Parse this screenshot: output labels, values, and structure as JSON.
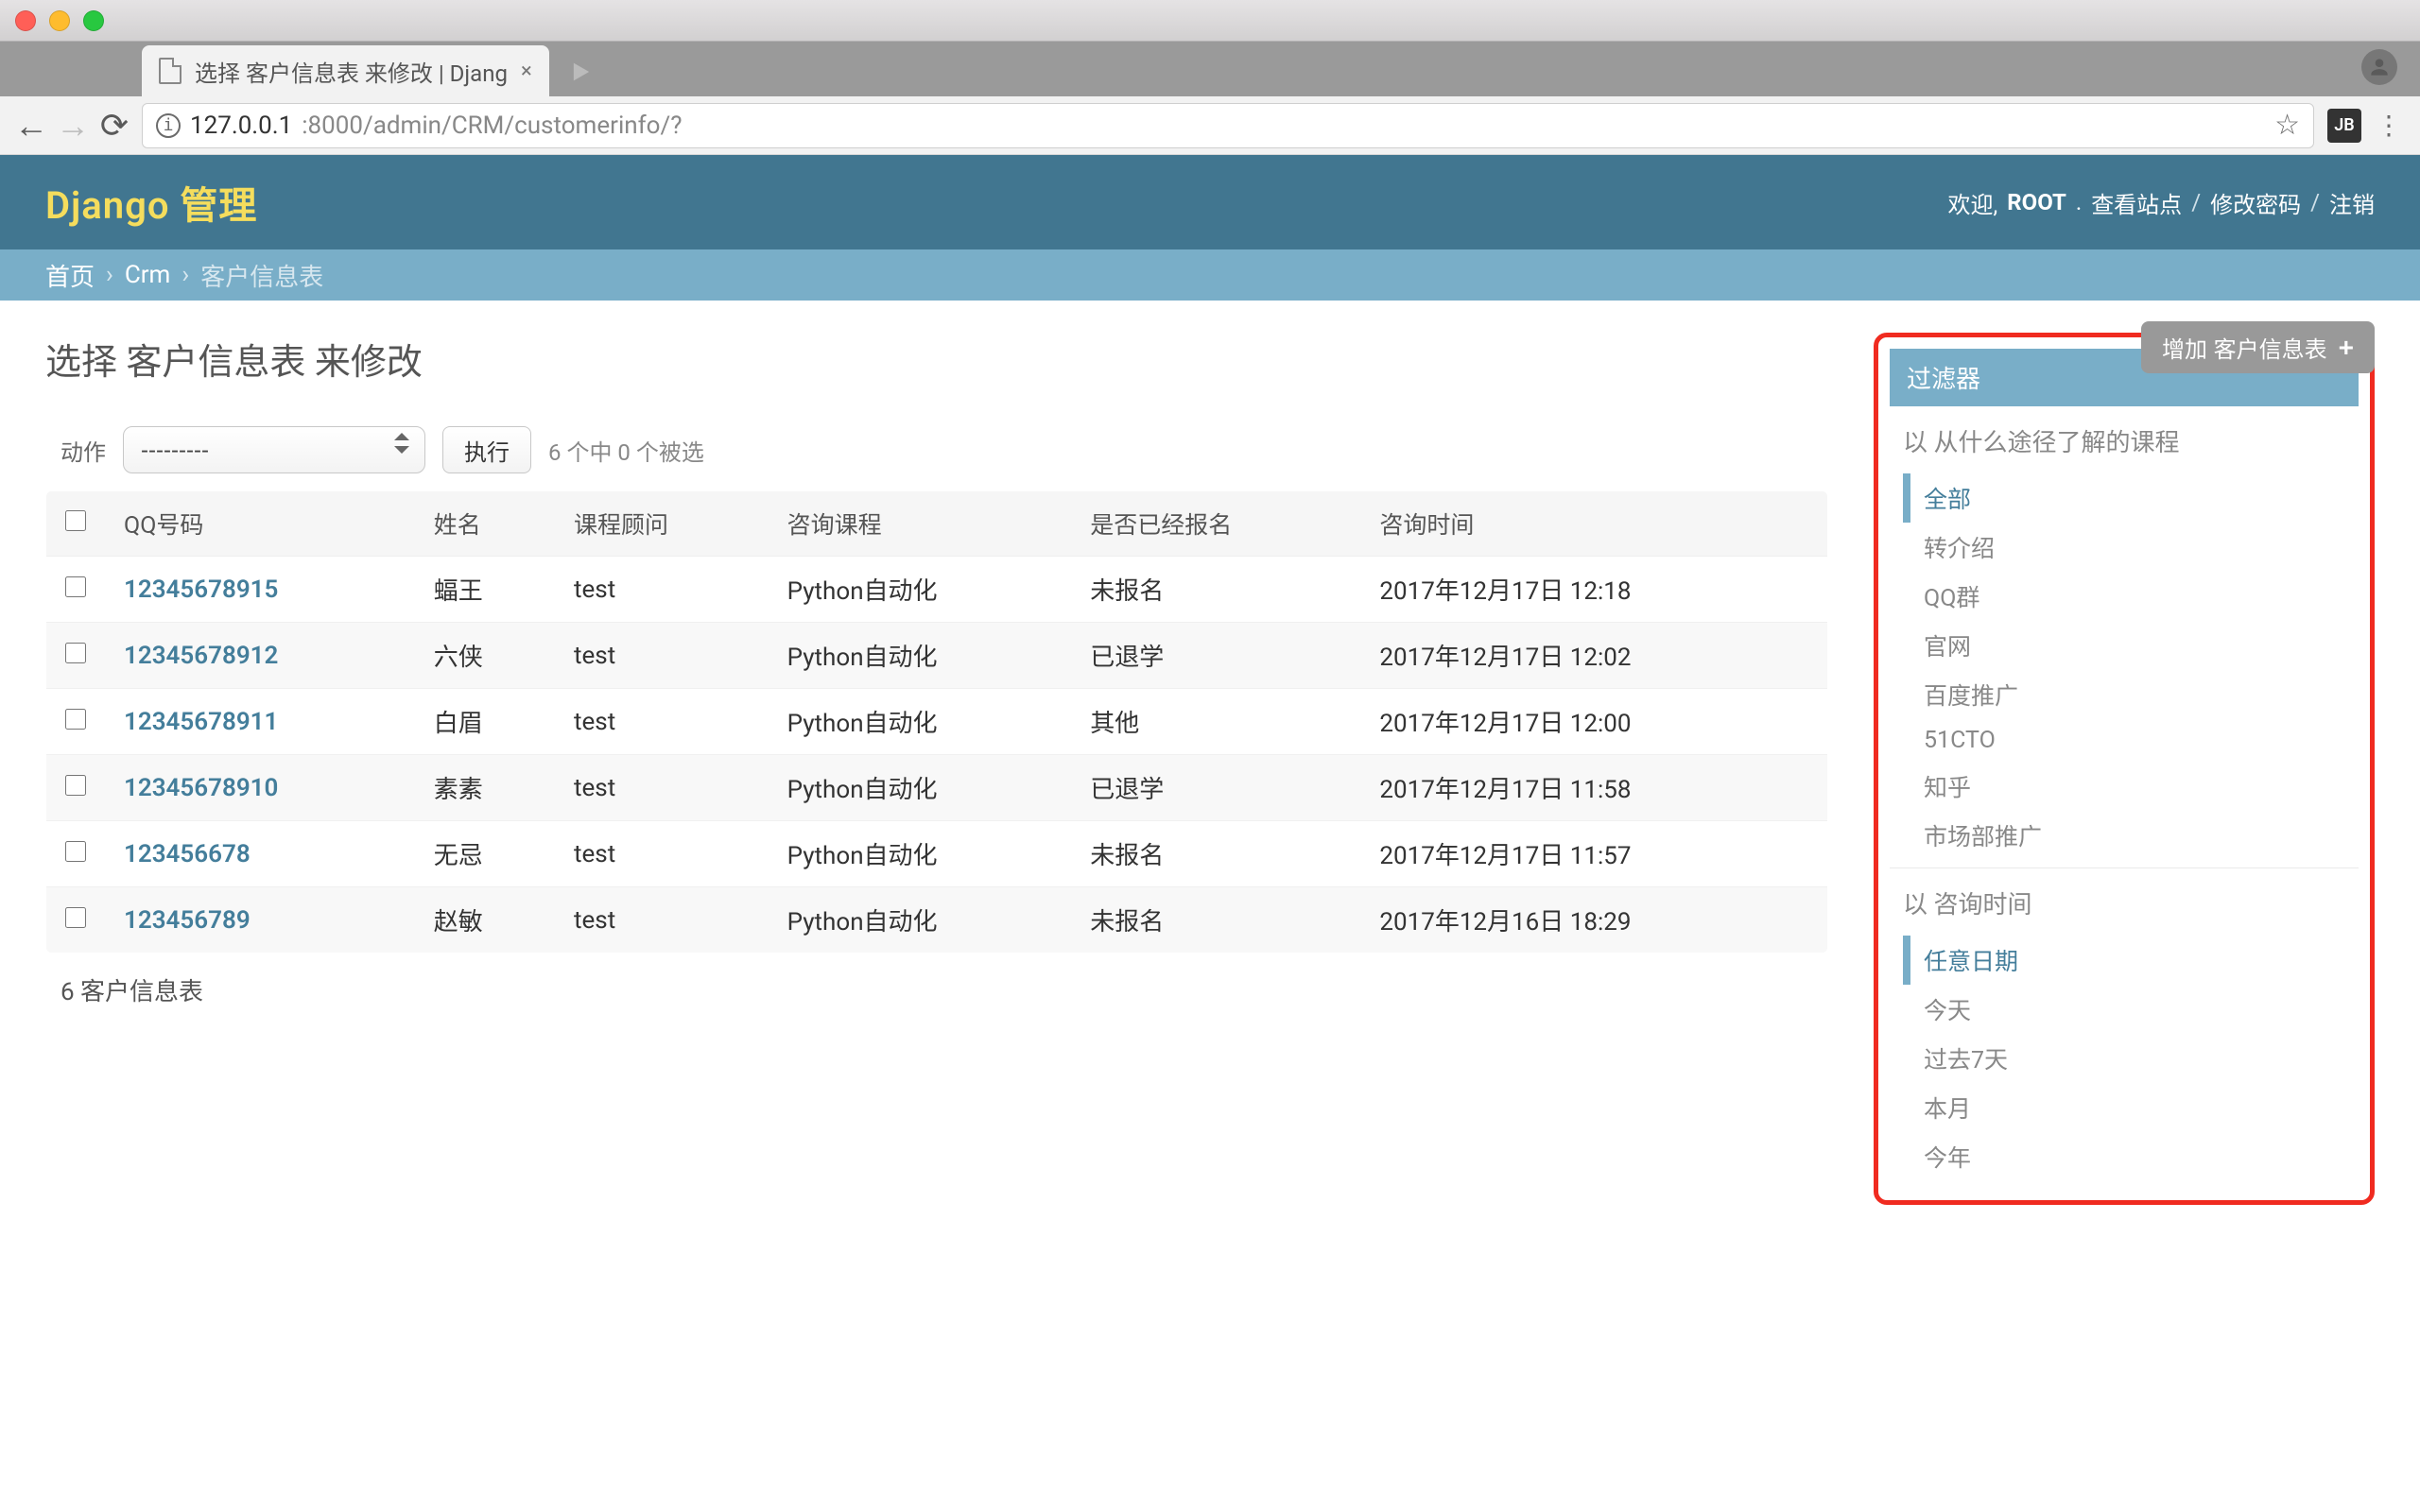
{
  "browser": {
    "tab_title": "选择 客户信息表 来修改 | Djang",
    "url_host": "127.0.0.1",
    "url_port_path": ":8000/admin/CRM/customerinfo/?"
  },
  "header": {
    "brand": "Django 管理",
    "welcome": "欢迎,",
    "user": "ROOT",
    "links": {
      "view_site": "查看站点",
      "change_password": "修改密码",
      "logout": "注销"
    }
  },
  "breadcrumbs": {
    "home": "首页",
    "app": "Crm",
    "model": "客户信息表"
  },
  "page": {
    "title": "选择 客户信息表 来修改",
    "add_button": "增加 客户信息表",
    "action_label": "动作",
    "action_placeholder": "---------",
    "go_label": "执行",
    "selection_text": "6 个中 0 个被选",
    "paginator_text": "6 客户信息表"
  },
  "columns": [
    "",
    "QQ号码",
    "姓名",
    "课程顾问",
    "咨询课程",
    "是否已经报名",
    "咨询时间"
  ],
  "rows": [
    {
      "qq": "12345678915",
      "name": "蝠王",
      "advisor": "test",
      "course": "Python自动化",
      "status": "未报名",
      "time": "2017年12月17日 12:18"
    },
    {
      "qq": "12345678912",
      "name": "六侠",
      "advisor": "test",
      "course": "Python自动化",
      "status": "已退学",
      "time": "2017年12月17日 12:02"
    },
    {
      "qq": "12345678911",
      "name": "白眉",
      "advisor": "test",
      "course": "Python自动化",
      "status": "其他",
      "time": "2017年12月17日 12:00"
    },
    {
      "qq": "12345678910",
      "name": "素素",
      "advisor": "test",
      "course": "Python自动化",
      "status": "已退学",
      "time": "2017年12月17日 11:58"
    },
    {
      "qq": "123456678",
      "name": "无忌",
      "advisor": "test",
      "course": "Python自动化",
      "status": "未报名",
      "time": "2017年12月17日 11:57"
    },
    {
      "qq": "123456789",
      "name": "赵敏",
      "advisor": "test",
      "course": "Python自动化",
      "status": "未报名",
      "time": "2017年12月16日 18:29"
    }
  ],
  "filters": {
    "title": "过滤器",
    "groups": [
      {
        "heading": "以 从什么途径了解的课程",
        "selected_index": 0,
        "items": [
          "全部",
          "转介绍",
          "QQ群",
          "官网",
          "百度推广",
          "51CTO",
          "知乎",
          "市场部推广"
        ]
      },
      {
        "heading": "以 咨询时间",
        "selected_index": 0,
        "items": [
          "任意日期",
          "今天",
          "过去7天",
          "本月",
          "今年"
        ]
      }
    ]
  }
}
